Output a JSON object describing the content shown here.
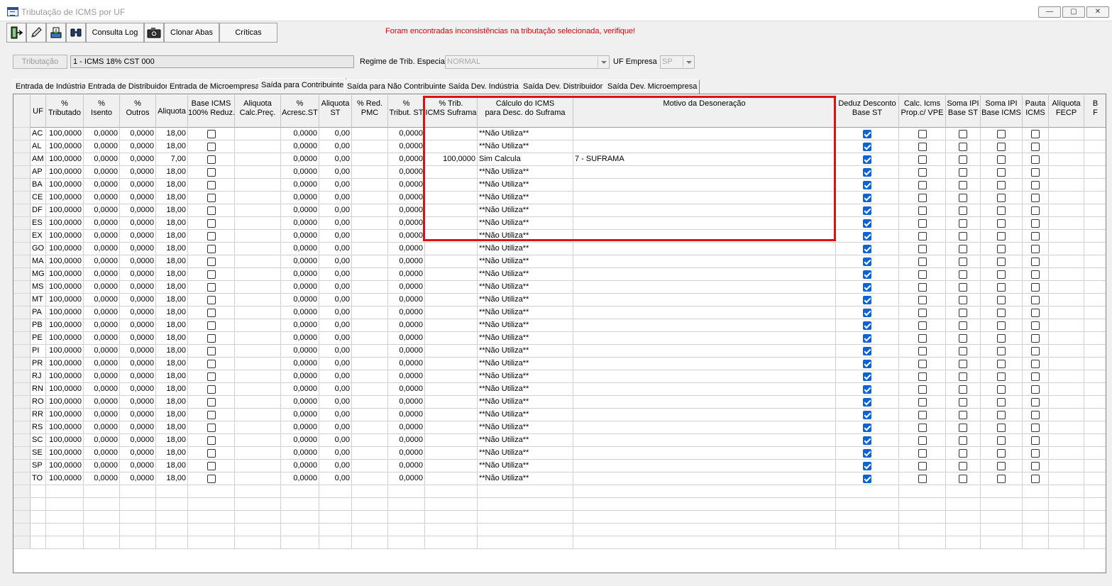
{
  "window": {
    "title": "Tributação de ICMS por UF",
    "min": "—",
    "max": "▢",
    "close": "✕"
  },
  "toolbar": {
    "consulta_log": "Consulta Log",
    "clonar_abas": "Clonar Abas",
    "criticas": "Críticas"
  },
  "warning": "Foram encontradas inconsistências na tributação selecionada, verifique!",
  "criteria": {
    "tributacao_button": "Tributação",
    "tributacao_value": "1 - ICMS 18% CST 000",
    "regime_label": "Regime de Trib. Especial",
    "regime_value": "NORMAL",
    "uf_label": "UF Empresa",
    "uf_value": "SP"
  },
  "tabs": [
    "Entrada de Indústria",
    "Entrada de Distribuidor",
    "Entrada de Microempresa",
    "Saída para Contribuinte",
    "Saída para Não Contribuinte",
    "Saída Dev. Indústria",
    "Saída Dev. Distribuidor",
    "Saída Dev. Microempresa"
  ],
  "active_tab": 3,
  "columns": [
    [
      "UF"
    ],
    [
      "%",
      "Tributado"
    ],
    [
      "%",
      "Isento"
    ],
    [
      "%",
      "Outros"
    ],
    [
      "Aliquota"
    ],
    [
      "Base ICMS",
      "100% Reduz."
    ],
    [
      "Aliquota",
      "Calc.Preç."
    ],
    [
      "%",
      "Acresc.ST"
    ],
    [
      "Aliquota",
      "ST"
    ],
    [
      "% Red.",
      "PMC"
    ],
    [
      "%",
      "Tribut. ST"
    ],
    [
      "% Trib.",
      "ICMS Suframa"
    ],
    [
      "Cálculo do ICMS",
      "para Desc. do Suframa"
    ],
    [
      "Motivo da Desoneração"
    ],
    [
      "Deduz Desconto",
      "Base ST"
    ],
    [
      "Calc. Icms",
      "Prop.c/ VPE"
    ],
    [
      "Soma IPI",
      "Base ST"
    ],
    [
      "Soma IPI",
      "Base ICMS"
    ],
    [
      "Pauta",
      "ICMS"
    ],
    [
      "Alíquota",
      "FECP"
    ],
    [
      "B",
      "F"
    ]
  ],
  "rows": [
    {
      "uf": "AC",
      "trib": "100,0000",
      "isento": "0,0000",
      "outros": "0,0000",
      "aliq": "18,00",
      "acresc": "0,0000",
      "aliq_st": "0,00",
      "trib_st": "0,0000",
      "suframa": "",
      "calc": "**Não Utiliza**",
      "motivo": ""
    },
    {
      "uf": "AL",
      "trib": "100,0000",
      "isento": "0,0000",
      "outros": "0,0000",
      "aliq": "18,00",
      "acresc": "0,0000",
      "aliq_st": "0,00",
      "trib_st": "0,0000",
      "suframa": "",
      "calc": "**Não Utiliza**",
      "motivo": ""
    },
    {
      "uf": "AM",
      "trib": "100,0000",
      "isento": "0,0000",
      "outros": "0,0000",
      "aliq": "7,00",
      "acresc": "0,0000",
      "aliq_st": "0,00",
      "trib_st": "0,0000",
      "suframa": "100,0000",
      "calc": "Sim Calcula",
      "motivo": "7 - SUFRAMA"
    },
    {
      "uf": "AP",
      "trib": "100,0000",
      "isento": "0,0000",
      "outros": "0,0000",
      "aliq": "18,00",
      "acresc": "0,0000",
      "aliq_st": "0,00",
      "trib_st": "0,0000",
      "suframa": "",
      "calc": "**Não Utiliza**",
      "motivo": ""
    },
    {
      "uf": "BA",
      "trib": "100,0000",
      "isento": "0,0000",
      "outros": "0,0000",
      "aliq": "18,00",
      "acresc": "0,0000",
      "aliq_st": "0,00",
      "trib_st": "0,0000",
      "suframa": "",
      "calc": "**Não Utiliza**",
      "motivo": ""
    },
    {
      "uf": "CE",
      "trib": "100,0000",
      "isento": "0,0000",
      "outros": "0,0000",
      "aliq": "18,00",
      "acresc": "0,0000",
      "aliq_st": "0,00",
      "trib_st": "0,0000",
      "suframa": "",
      "calc": "**Não Utiliza**",
      "motivo": ""
    },
    {
      "uf": "DF",
      "trib": "100,0000",
      "isento": "0,0000",
      "outros": "0,0000",
      "aliq": "18,00",
      "acresc": "0,0000",
      "aliq_st": "0,00",
      "trib_st": "0,0000",
      "suframa": "",
      "calc": "**Não Utiliza**",
      "motivo": ""
    },
    {
      "uf": "ES",
      "trib": "100,0000",
      "isento": "0,0000",
      "outros": "0,0000",
      "aliq": "18,00",
      "acresc": "0,0000",
      "aliq_st": "0,00",
      "trib_st": "0,0000",
      "suframa": "",
      "calc": "**Não Utiliza**",
      "motivo": ""
    },
    {
      "uf": "EX",
      "trib": "100,0000",
      "isento": "0,0000",
      "outros": "0,0000",
      "aliq": "18,00",
      "acresc": "0,0000",
      "aliq_st": "0,00",
      "trib_st": "0,0000",
      "suframa": "",
      "calc": "**Não Utiliza**",
      "motivo": ""
    },
    {
      "uf": "GO",
      "trib": "100,0000",
      "isento": "0,0000",
      "outros": "0,0000",
      "aliq": "18,00",
      "acresc": "0,0000",
      "aliq_st": "0,00",
      "trib_st": "0,0000",
      "suframa": "",
      "calc": "**Não Utiliza**",
      "motivo": ""
    },
    {
      "uf": "MA",
      "trib": "100,0000",
      "isento": "0,0000",
      "outros": "0,0000",
      "aliq": "18,00",
      "acresc": "0,0000",
      "aliq_st": "0,00",
      "trib_st": "0,0000",
      "suframa": "",
      "calc": "**Não Utiliza**",
      "motivo": ""
    },
    {
      "uf": "MG",
      "trib": "100,0000",
      "isento": "0,0000",
      "outros": "0,0000",
      "aliq": "18,00",
      "acresc": "0,0000",
      "aliq_st": "0,00",
      "trib_st": "0,0000",
      "suframa": "",
      "calc": "**Não Utiliza**",
      "motivo": ""
    },
    {
      "uf": "MS",
      "trib": "100,0000",
      "isento": "0,0000",
      "outros": "0,0000",
      "aliq": "18,00",
      "acresc": "0,0000",
      "aliq_st": "0,00",
      "trib_st": "0,0000",
      "suframa": "",
      "calc": "**Não Utiliza**",
      "motivo": ""
    },
    {
      "uf": "MT",
      "trib": "100,0000",
      "isento": "0,0000",
      "outros": "0,0000",
      "aliq": "18,00",
      "acresc": "0,0000",
      "aliq_st": "0,00",
      "trib_st": "0,0000",
      "suframa": "",
      "calc": "**Não Utiliza**",
      "motivo": ""
    },
    {
      "uf": "PA",
      "trib": "100,0000",
      "isento": "0,0000",
      "outros": "0,0000",
      "aliq": "18,00",
      "acresc": "0,0000",
      "aliq_st": "0,00",
      "trib_st": "0,0000",
      "suframa": "",
      "calc": "**Não Utiliza**",
      "motivo": ""
    },
    {
      "uf": "PB",
      "trib": "100,0000",
      "isento": "0,0000",
      "outros": "0,0000",
      "aliq": "18,00",
      "acresc": "0,0000",
      "aliq_st": "0,00",
      "trib_st": "0,0000",
      "suframa": "",
      "calc": "**Não Utiliza**",
      "motivo": ""
    },
    {
      "uf": "PE",
      "trib": "100,0000",
      "isento": "0,0000",
      "outros": "0,0000",
      "aliq": "18,00",
      "acresc": "0,0000",
      "aliq_st": "0,00",
      "trib_st": "0,0000",
      "suframa": "",
      "calc": "**Não Utiliza**",
      "motivo": ""
    },
    {
      "uf": "PI",
      "trib": "100,0000",
      "isento": "0,0000",
      "outros": "0,0000",
      "aliq": "18,00",
      "acresc": "0,0000",
      "aliq_st": "0,00",
      "trib_st": "0,0000",
      "suframa": "",
      "calc": "**Não Utiliza**",
      "motivo": ""
    },
    {
      "uf": "PR",
      "trib": "100,0000",
      "isento": "0,0000",
      "outros": "0,0000",
      "aliq": "18,00",
      "acresc": "0,0000",
      "aliq_st": "0,00",
      "trib_st": "0,0000",
      "suframa": "",
      "calc": "**Não Utiliza**",
      "motivo": ""
    },
    {
      "uf": "RJ",
      "trib": "100,0000",
      "isento": "0,0000",
      "outros": "0,0000",
      "aliq": "18,00",
      "acresc": "0,0000",
      "aliq_st": "0,00",
      "trib_st": "0,0000",
      "suframa": "",
      "calc": "**Não Utiliza**",
      "motivo": ""
    },
    {
      "uf": "RN",
      "trib": "100,0000",
      "isento": "0,0000",
      "outros": "0,0000",
      "aliq": "18,00",
      "acresc": "0,0000",
      "aliq_st": "0,00",
      "trib_st": "0,0000",
      "suframa": "",
      "calc": "**Não Utiliza**",
      "motivo": ""
    },
    {
      "uf": "RO",
      "trib": "100,0000",
      "isento": "0,0000",
      "outros": "0,0000",
      "aliq": "18,00",
      "acresc": "0,0000",
      "aliq_st": "0,00",
      "trib_st": "0,0000",
      "suframa": "",
      "calc": "**Não Utiliza**",
      "motivo": ""
    },
    {
      "uf": "RR",
      "trib": "100,0000",
      "isento": "0,0000",
      "outros": "0,0000",
      "aliq": "18,00",
      "acresc": "0,0000",
      "aliq_st": "0,00",
      "trib_st": "0,0000",
      "suframa": "",
      "calc": "**Não Utiliza**",
      "motivo": ""
    },
    {
      "uf": "RS",
      "trib": "100,0000",
      "isento": "0,0000",
      "outros": "0,0000",
      "aliq": "18,00",
      "acresc": "0,0000",
      "aliq_st": "0,00",
      "trib_st": "0,0000",
      "suframa": "",
      "calc": "**Não Utiliza**",
      "motivo": ""
    },
    {
      "uf": "SC",
      "trib": "100,0000",
      "isento": "0,0000",
      "outros": "0,0000",
      "aliq": "18,00",
      "acresc": "0,0000",
      "aliq_st": "0,00",
      "trib_st": "0,0000",
      "suframa": "",
      "calc": "**Não Utiliza**",
      "motivo": ""
    },
    {
      "uf": "SE",
      "trib": "100,0000",
      "isento": "0,0000",
      "outros": "0,0000",
      "aliq": "18,00",
      "acresc": "0,0000",
      "aliq_st": "0,00",
      "trib_st": "0,0000",
      "suframa": "",
      "calc": "**Não Utiliza**",
      "motivo": ""
    },
    {
      "uf": "SP",
      "trib": "100,0000",
      "isento": "0,0000",
      "outros": "0,0000",
      "aliq": "18,00",
      "acresc": "0,0000",
      "aliq_st": "0,00",
      "trib_st": "0,0000",
      "suframa": "",
      "calc": "**Não Utiliza**",
      "motivo": ""
    },
    {
      "uf": "TO",
      "trib": "100,0000",
      "isento": "0,0000",
      "outros": "0,0000",
      "aliq": "18,00",
      "acresc": "0,0000",
      "aliq_st": "0,00",
      "trib_st": "0,0000",
      "suframa": "",
      "calc": "**Não Utiliza**",
      "motivo": ""
    }
  ],
  "checkbox_defaults": {
    "deduz_desconto": true,
    "calc_icms_prop": false,
    "soma_ipi_st": false,
    "soma_ipi_icms": false,
    "pauta_icms": false,
    "base_icms_reduz": false
  },
  "colors": {
    "highlight": "#e01010",
    "warning": "#e00000",
    "checked": "#0a64d2"
  },
  "icons": [
    "exit-icon",
    "edit-icon",
    "save-icon",
    "search-binoculars-icon",
    "camera-icon"
  ]
}
